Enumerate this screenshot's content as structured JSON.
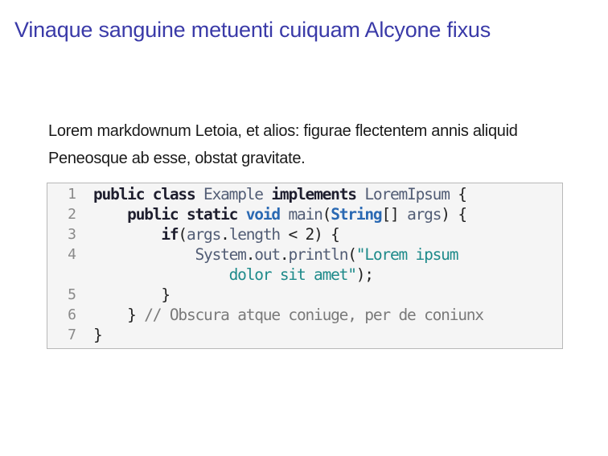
{
  "page": {
    "title": "Vinaque sanguine metuenti cuiquam Alcyone fixus"
  },
  "paragraph": {
    "line1": "Lorem markdownum Letoia, et alios: figurae flectentem annis aliquid",
    "line2": "Peneosque ab esse, obstat gravitate."
  },
  "code": {
    "line_numbers": [
      "1",
      "2",
      "3",
      "4",
      "5",
      "6",
      "7"
    ],
    "l1": {
      "kw1": "public",
      "kw2": "class",
      "name": "Example",
      "kw3": "implements",
      "iface": "LoremIpsum",
      "brace": " {"
    },
    "l2": {
      "indent": "    ",
      "kw1": "public",
      "kw2": "static",
      "type": "void",
      "method": "main",
      "open": "(",
      "param_type": "String",
      "brackets": "[] ",
      "param": "args",
      "close": ") {"
    },
    "l3": {
      "indent": "        ",
      "kw": "if",
      "open": "(",
      "expr1": "args",
      "dot": ".",
      "expr2": "length",
      "rest": " < 2) {"
    },
    "l4": {
      "indent": "            ",
      "obj": "System",
      "dot1": ".",
      "field": "out",
      "dot2": ".",
      "call": "println",
      "open": "(",
      "str": "\"Lorem ipsum"
    },
    "l4b": {
      "indent": "                ",
      "str": "dolor sit amet\"",
      "close": ");"
    },
    "l5": {
      "text": "        }"
    },
    "l6": {
      "brace": "    } ",
      "comment": "// Obscura atque coniuge, per de coniunx"
    },
    "l7": {
      "text": "}"
    }
  }
}
